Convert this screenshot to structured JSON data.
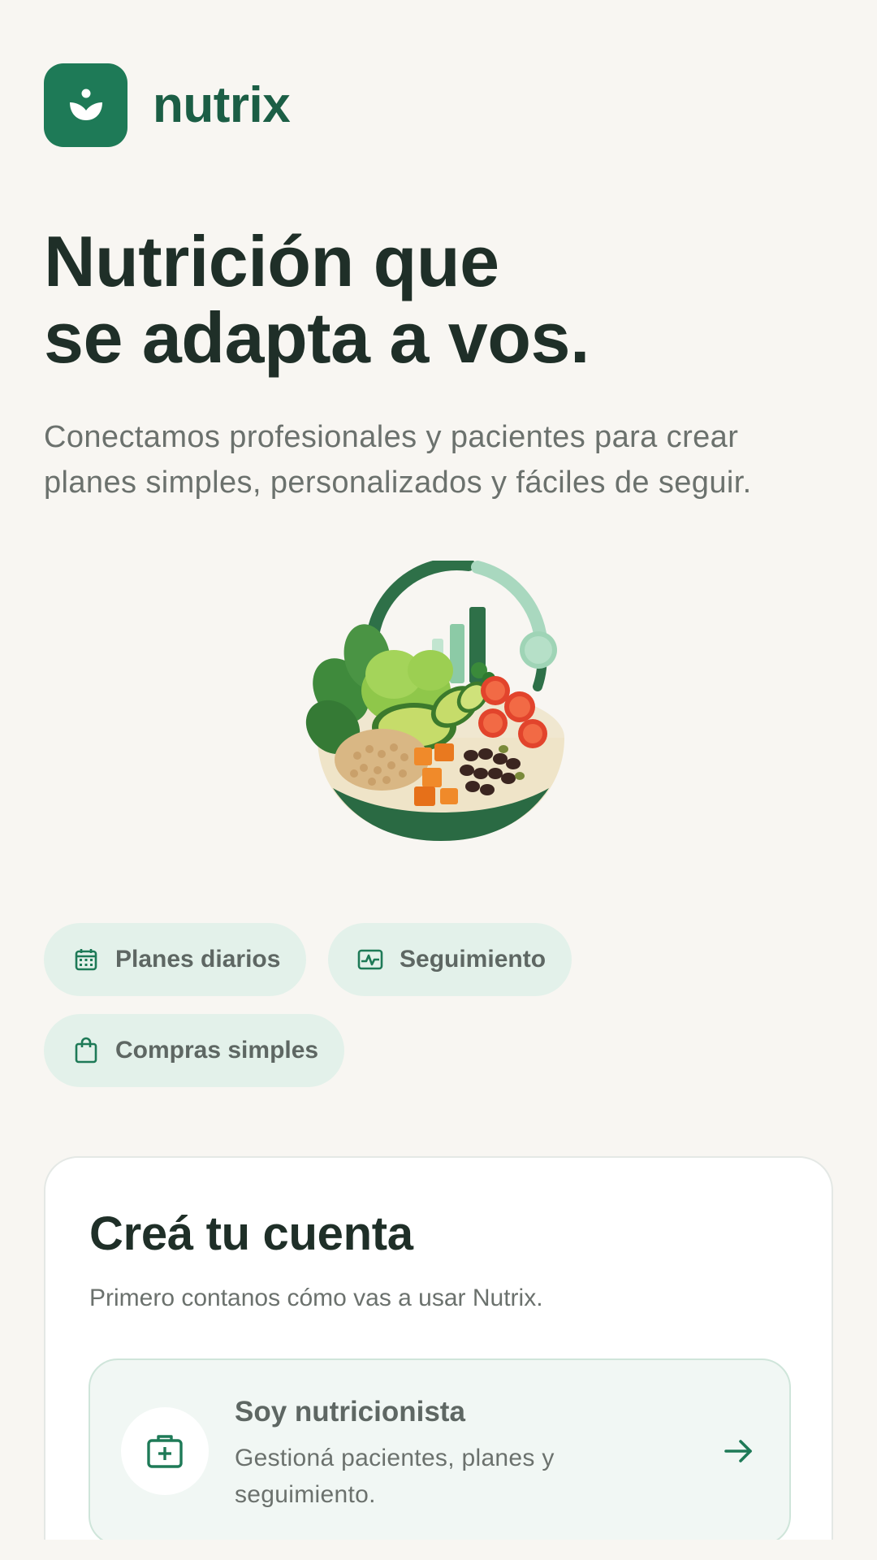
{
  "brand": {
    "name": "nutrix",
    "logo_icon": "sprout-icon",
    "color": "#1e7a57"
  },
  "hero": {
    "title_lines": [
      "Nutrición que",
      "se adapta a vos."
    ],
    "subtitle_lines": [
      "Conectamos profesionales y pacientes para crear",
      "planes simples, personalizados y fáciles de seguir."
    ],
    "illustration": "salad-bowl-progress-illustration"
  },
  "features": [
    {
      "label": "Planes diarios",
      "icon": "calendar-icon"
    },
    {
      "label": "Seguimiento",
      "icon": "activity-chart-icon"
    },
    {
      "label": "Compras simples",
      "icon": "shopping-bag-icon"
    }
  ],
  "signup": {
    "title": "Creá tu cuenta",
    "subtitle": "Primero contanos cómo vas a usar Nutrix.",
    "options": [
      {
        "title": "Soy nutricionista",
        "description_lines": [
          "Gestioná pacientes, planes y",
          "seguimiento."
        ],
        "icon": "medical-kit-icon",
        "action_icon": "arrow-right-icon"
      }
    ]
  },
  "colors": {
    "background": "#f8f6f2",
    "accent": "#1e7a57",
    "chip_background": "#e3f1ea",
    "heading": "#1f2f28",
    "muted_text": "#6b716d"
  }
}
